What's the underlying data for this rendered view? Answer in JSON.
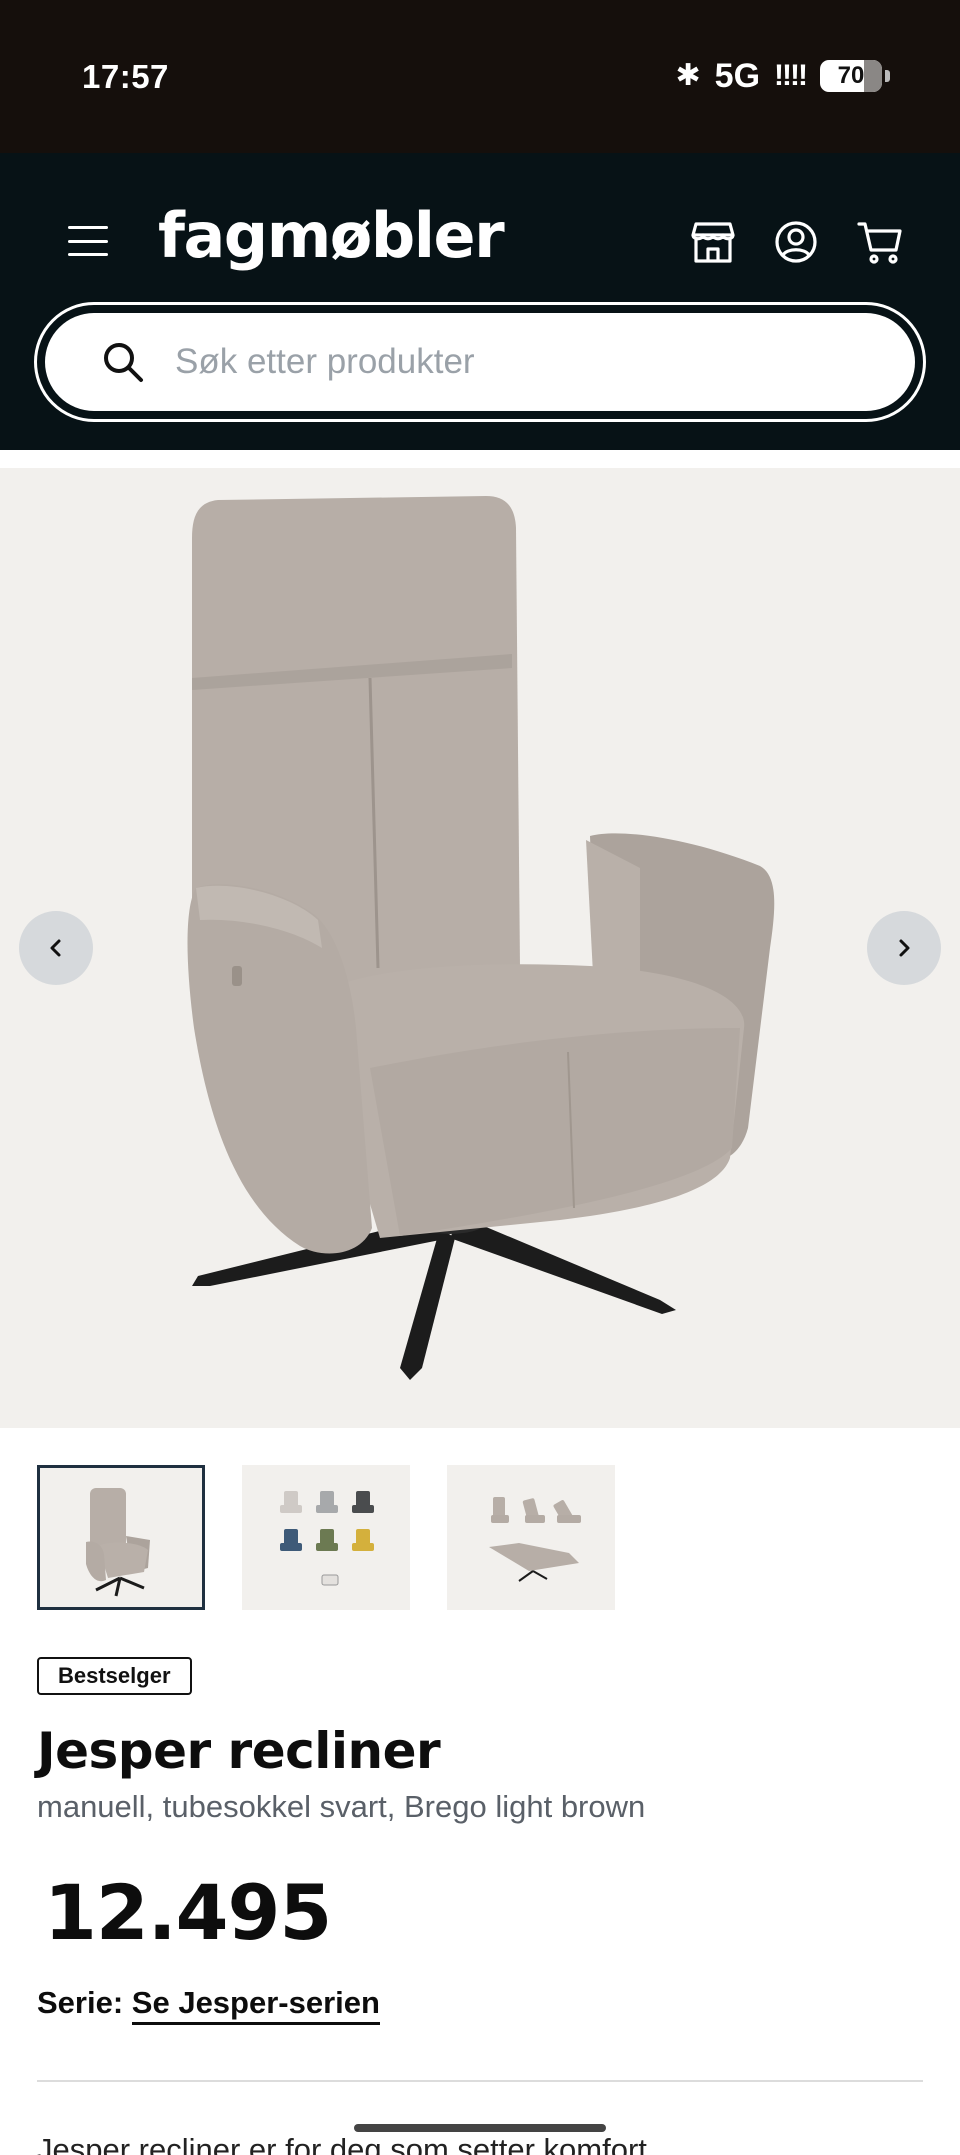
{
  "status_bar": {
    "time": "17:57",
    "bluetooth": "✱",
    "network": "5G",
    "signal": "!!!!",
    "battery": "70"
  },
  "header": {
    "logo": "fagmøbler",
    "icons": [
      "menu-icon",
      "store-icon",
      "account-icon",
      "cart-icon"
    ]
  },
  "search": {
    "placeholder": "Søk etter produkter"
  },
  "gallery": {
    "prev_label": "‹",
    "next_label": "›",
    "thumbnails": [
      "chair-front",
      "color-variants",
      "recline-positions"
    ],
    "active_thumbnail": 0
  },
  "product": {
    "badge": "Bestselger",
    "title": "Jesper recliner",
    "variant": "manuell, tubesokkel svart, Brego light brown",
    "price": "12.495",
    "series_label": "Serie:",
    "series_link": "Se Jesper-serien",
    "description_peek": "Jesper recliner er for deg som setter komfort"
  },
  "colors": {
    "header_bg": "#071216",
    "status_bg": "#150f0c",
    "gallery_bg": "#f2f0ed",
    "fabric": "#b5aca5"
  }
}
